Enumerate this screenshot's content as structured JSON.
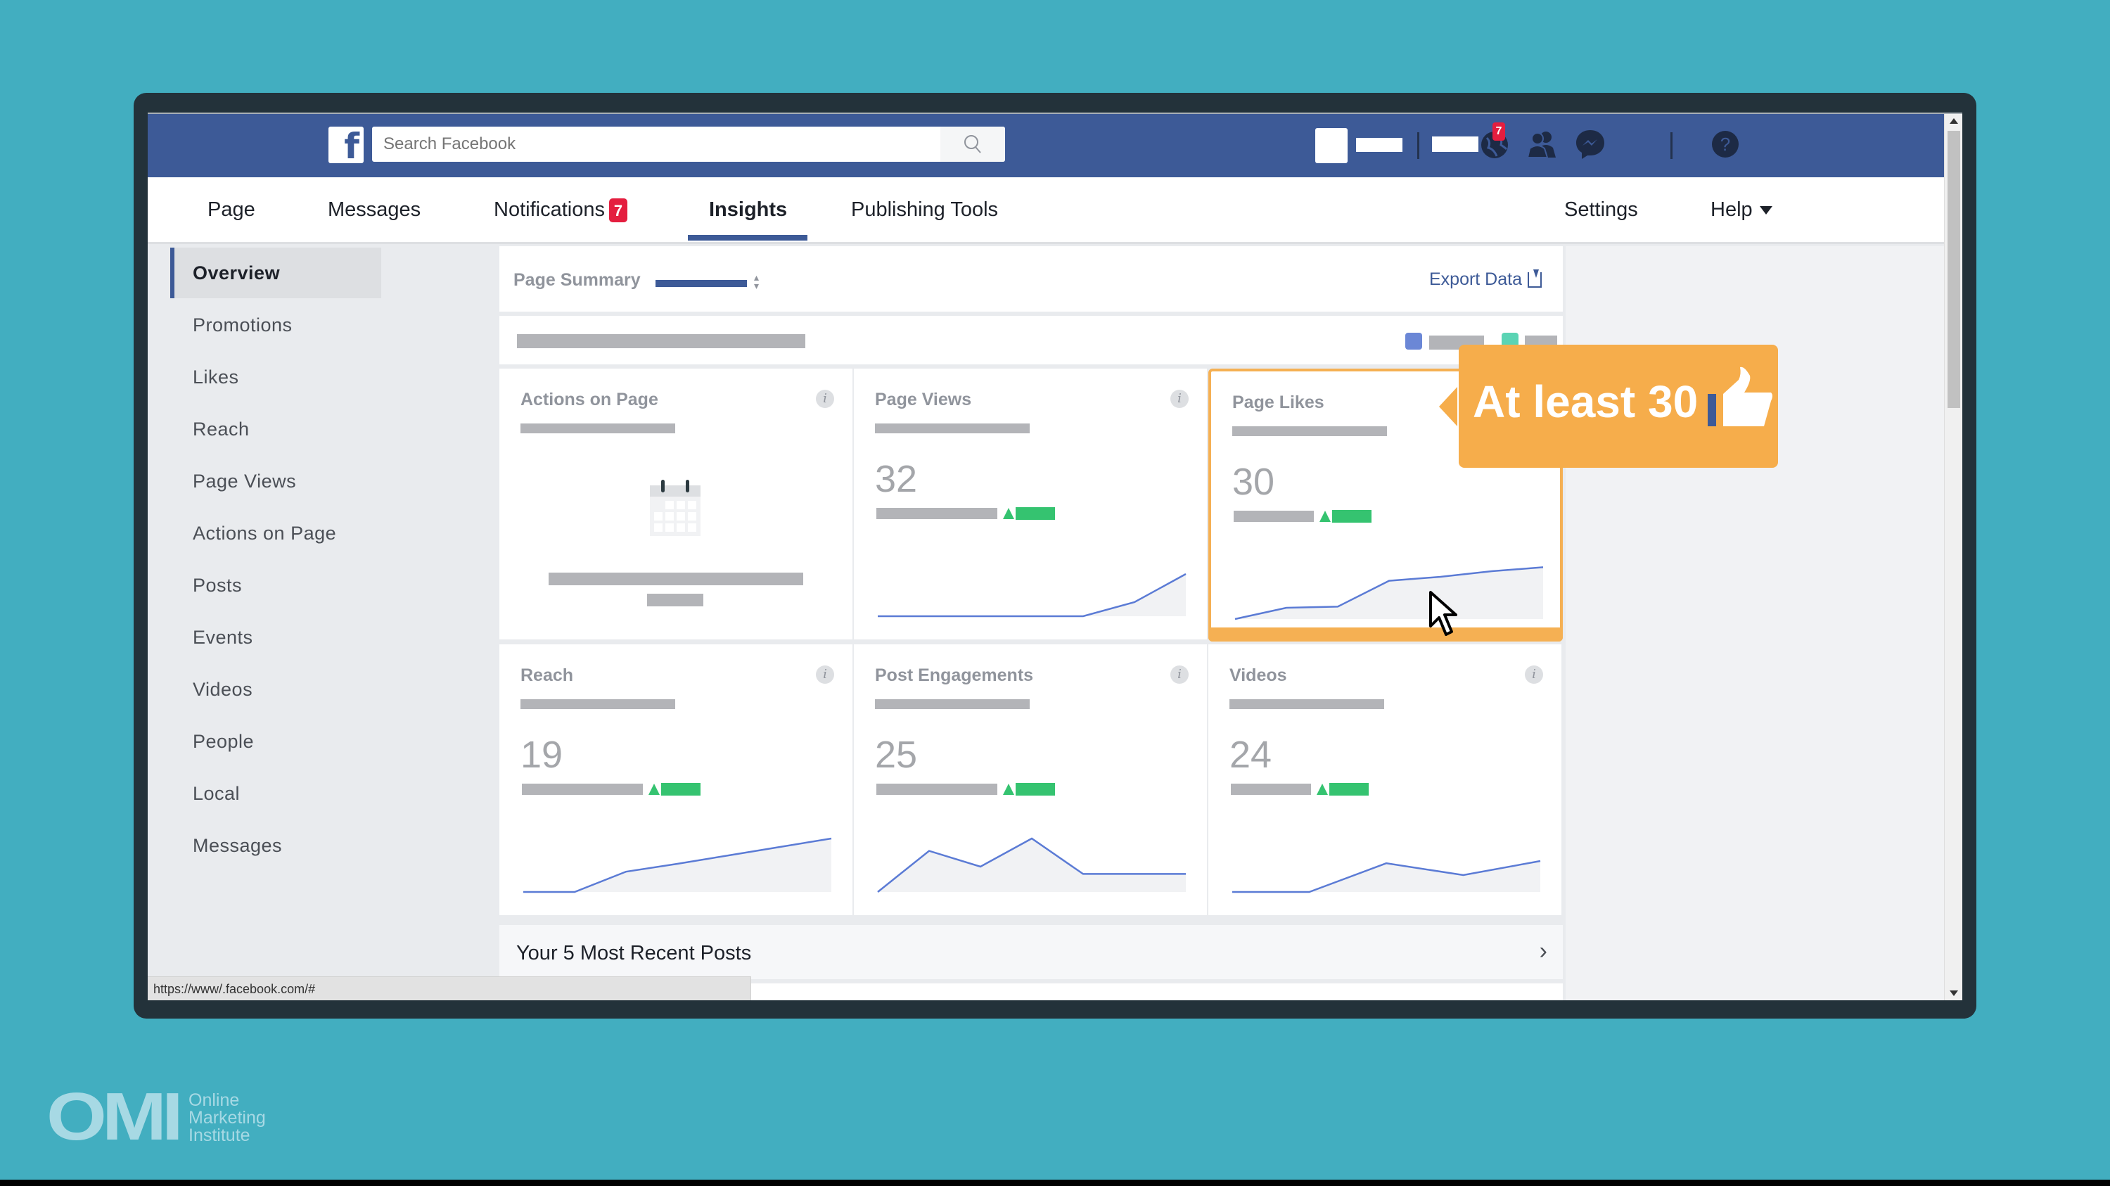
{
  "topbar": {
    "logo_icon": "facebook-f-icon",
    "search_placeholder": "Search Facebook",
    "search_icon": "search-icon",
    "icons": [
      "friends-icon",
      "messenger-icon",
      "globe-notifications-icon",
      "help-icon"
    ],
    "notifications_badge": "7",
    "brand_color": "#3d5a97"
  },
  "nav": {
    "items": [
      {
        "label": "Page"
      },
      {
        "label": "Messages"
      },
      {
        "label": "Notifications",
        "badge": "7"
      },
      {
        "label": "Insights",
        "active": true
      },
      {
        "label": "Publishing Tools"
      }
    ],
    "right_items": [
      {
        "label": "Settings"
      },
      {
        "label": "Help"
      }
    ]
  },
  "sidebar": {
    "items": [
      {
        "label": "Overview",
        "active": true
      },
      {
        "label": "Promotions"
      },
      {
        "label": "Likes"
      },
      {
        "label": "Reach"
      },
      {
        "label": "Page Views"
      },
      {
        "label": "Actions on Page"
      },
      {
        "label": "Posts"
      },
      {
        "label": "Events"
      },
      {
        "label": "Videos"
      },
      {
        "label": "People"
      },
      {
        "label": "Local"
      },
      {
        "label": "Messages"
      }
    ]
  },
  "summary": {
    "title": "Page Summary",
    "export_label": "Export Data",
    "legend_colors": [
      "#6b87d6",
      "#5bd4b4"
    ]
  },
  "metrics": [
    {
      "title": "Actions on Page",
      "value": null,
      "empty_state_icon": "calendar-icon",
      "spark": []
    },
    {
      "title": "Page Views",
      "value": "32",
      "trend": "up",
      "spark": [
        0,
        0,
        0,
        0,
        0,
        0.25,
        0.75
      ]
    },
    {
      "title": "Page Likes",
      "value": "30",
      "trend": "up",
      "highlighted": true,
      "spark": [
        0,
        0.2,
        0.22,
        0.68,
        0.75,
        0.85,
        0.92
      ]
    },
    {
      "title": "Reach",
      "value": "19",
      "trend": "up",
      "spark": [
        0,
        0,
        0.36,
        0.5,
        0.65,
        0.8,
        0.95
      ]
    },
    {
      "title": "Post Engagements",
      "value": "25",
      "trend": "up",
      "spark": [
        0,
        0.73,
        0.45,
        0.95,
        0.32,
        0.32,
        0.32
      ]
    },
    {
      "title": "Videos",
      "value": "24",
      "trend": "up",
      "spark": [
        0,
        0,
        0.51,
        0.3,
        0.55
      ]
    }
  ],
  "recent_posts": {
    "label": "Your 5 Most Recent Posts"
  },
  "callout": {
    "text": "At least 30",
    "icon": "thumbs-up-icon",
    "color": "#f6ad4b"
  },
  "status_bar": {
    "url": "https://www/.facebook.com/#"
  },
  "branding": {
    "logo_letters": "OMI",
    "logo_lines": [
      "Online",
      "Marketing",
      "Institute"
    ]
  }
}
